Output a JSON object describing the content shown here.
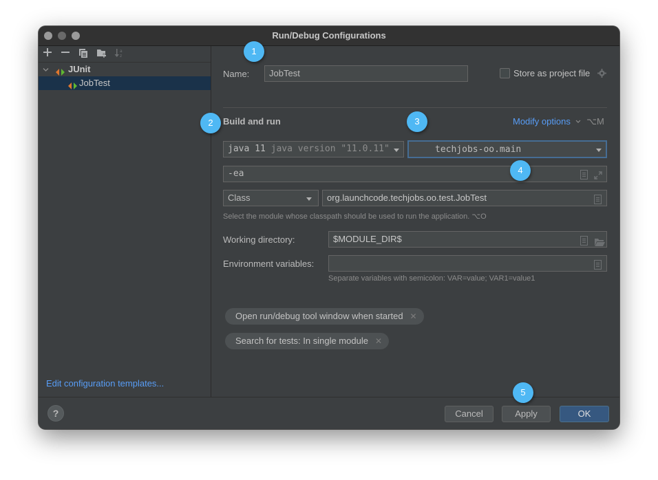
{
  "window": {
    "title": "Run/Debug Configurations"
  },
  "sidebar": {
    "toolbar": [
      {
        "name": "add",
        "icon": "plus-icon"
      },
      {
        "name": "remove",
        "icon": "minus-icon"
      },
      {
        "name": "copy",
        "icon": "copy-icon"
      },
      {
        "name": "new-folder",
        "icon": "folder-add-icon"
      },
      {
        "name": "sort",
        "icon": "sort-alpha-icon"
      }
    ],
    "tree": [
      {
        "label": "JUnit",
        "level": 0,
        "expanded": true,
        "selected": false
      },
      {
        "label": "JobTest",
        "level": 1,
        "selected": true
      }
    ],
    "edit_templates_link": "Edit configuration templates..."
  },
  "form": {
    "name_label": "Name:",
    "name_value": "JobTest",
    "store_as_project_file_label": "Store as project file",
    "store_as_project_file_checked": false,
    "build_and_run_title": "Build and run",
    "modify_options_label": "Modify options",
    "modify_options_shortcut": "⌥M",
    "jre_select": {
      "primary": "java 11",
      "secondary": "java version \"11.0.11\""
    },
    "module_select": "techjobs-oo.main",
    "vm_options_value": "-ea",
    "test_kind_select": "Class",
    "class_value": "org.launchcode.techjobs.oo.test.JobTest",
    "module_hint": "Select the module whose classpath should be used to run the application. ⌥O",
    "working_dir_label": "Working directory:",
    "working_dir_value": "$MODULE_DIR$",
    "env_vars_label": "Environment variables:",
    "env_vars_value": "",
    "env_vars_hint": "Separate variables with semicolon: VAR=value; VAR1=value1",
    "option_chips": [
      "Open run/debug tool window when started",
      "Search for tests: In single module"
    ]
  },
  "footer": {
    "help_label": "?",
    "cancel_label": "Cancel",
    "apply_label": "Apply",
    "ok_label": "OK"
  },
  "annotations": [
    "1",
    "2",
    "3",
    "4",
    "5"
  ],
  "colors": {
    "badge": "#4fb8f4",
    "link": "#589df6",
    "primary_button": "#365880",
    "selection": "#1a324a"
  }
}
